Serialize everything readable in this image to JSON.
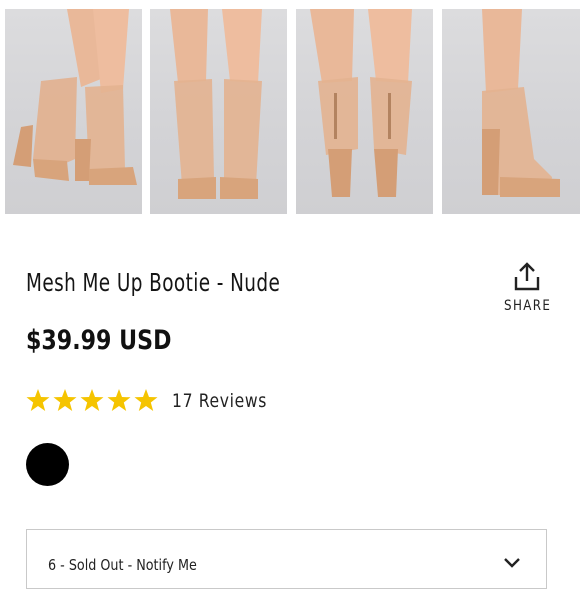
{
  "gallery": {
    "images": [
      {
        "alt": "",
        "icon": "product-photo-side"
      },
      {
        "alt": "",
        "icon": "product-photo-front"
      },
      {
        "alt": "",
        "icon": "product-photo-back"
      },
      {
        "alt": "",
        "icon": "product-photo-profile"
      }
    ]
  },
  "product": {
    "title": "Mesh Me Up Bootie - Nude",
    "price": "$39.99 USD",
    "rating": 5,
    "rating_max": 5,
    "reviews_label": "17 Reviews"
  },
  "share": {
    "label": "SHARE",
    "icon": "share-icon"
  },
  "swatches": [
    {
      "color": "#000000",
      "selected": false
    }
  ],
  "size_select": {
    "selected": "6 - Sold Out - Notify Me",
    "icon": "chevron-down-icon"
  },
  "colors": {
    "star": "#f5c400",
    "text": "#151515",
    "border": "#c9c9c9",
    "skin": "#e8b698",
    "shoe": "#dca77e"
  }
}
